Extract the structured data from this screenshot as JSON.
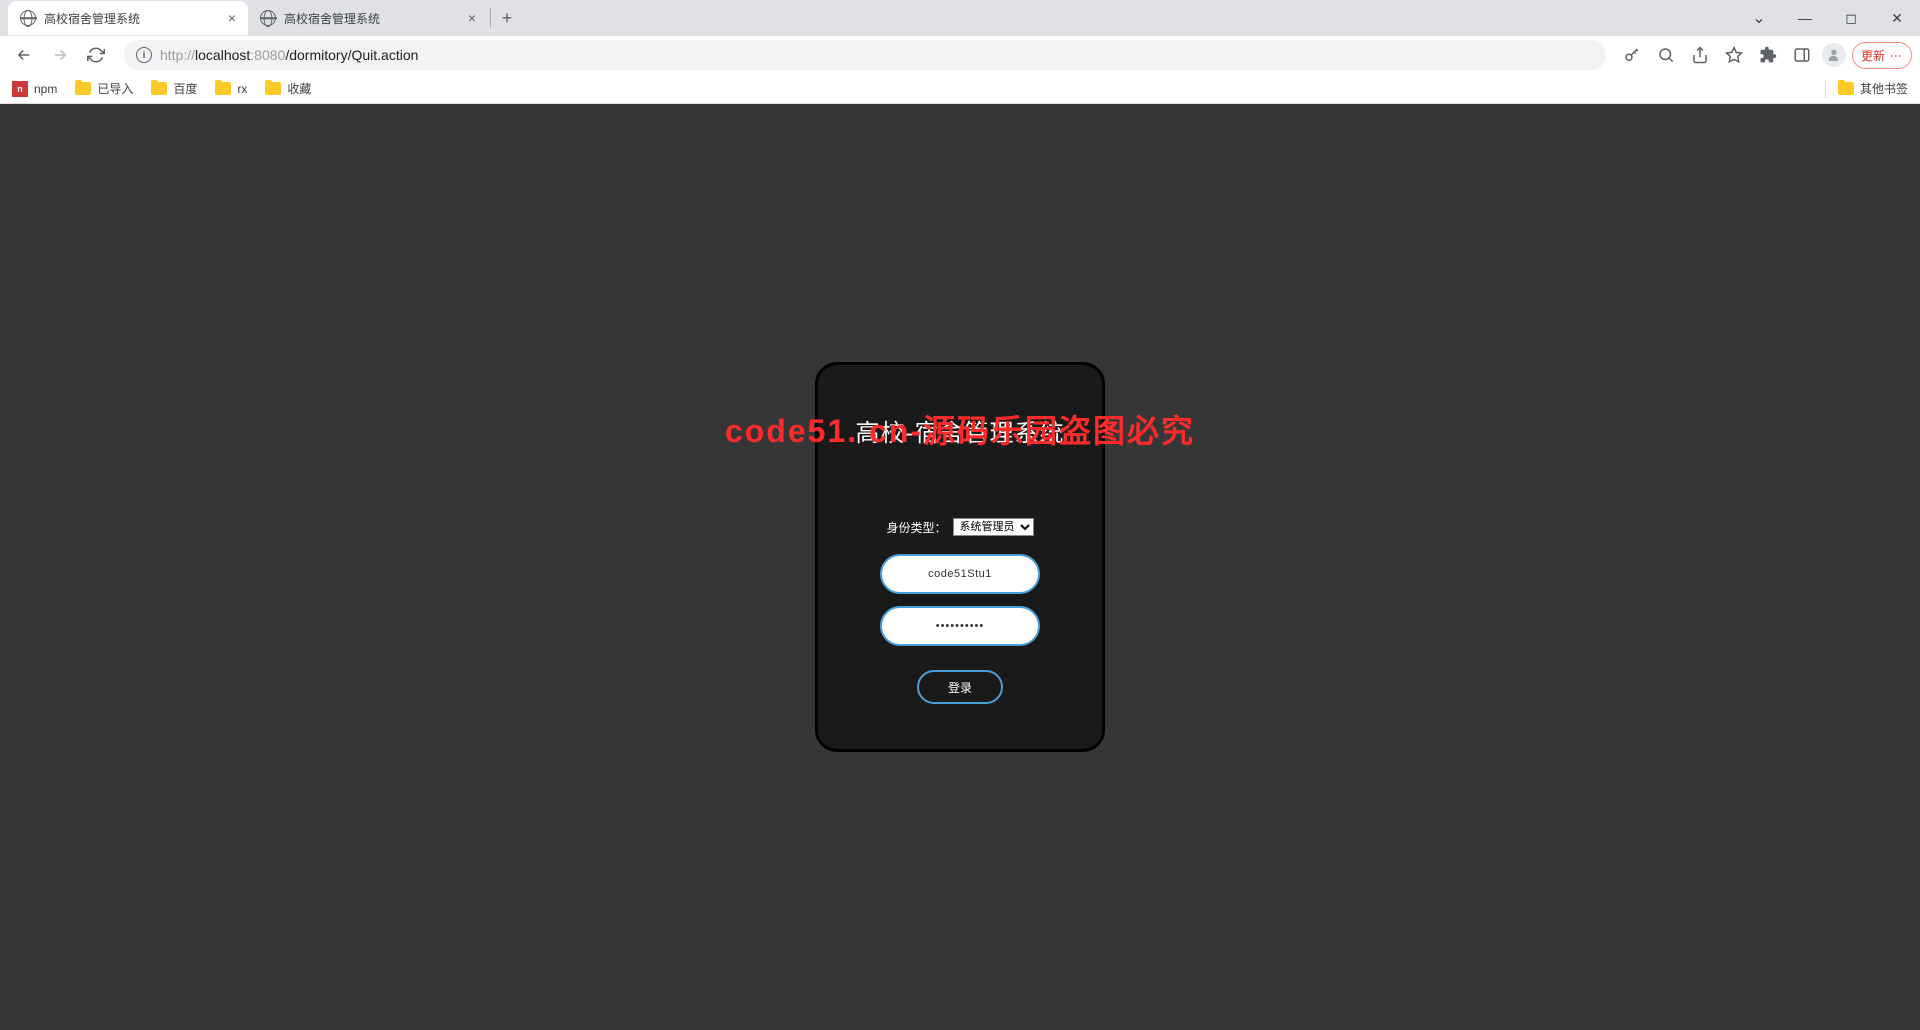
{
  "browser": {
    "tabs": [
      {
        "title": "高校宿舍管理系统",
        "active": true
      },
      {
        "title": "高校宿舍管理系统",
        "active": false
      }
    ],
    "url_prefix": "http://",
    "url_host": "localhost",
    "url_port": ":8080",
    "url_path": "/dormitory/Quit.action",
    "bookmarks": {
      "npm": "npm",
      "imported": "已导入",
      "baidu": "百度",
      "rx": "rx",
      "fav": "收藏",
      "other": "其他书签"
    },
    "update_label": "更新"
  },
  "watermark": "code51. cn-源码乐园盗图必究",
  "login": {
    "title": "高校-宿舍管理系统",
    "role_label": "身份类型：",
    "role_value": "系统管理员",
    "username": "code51Stu1",
    "password": "••••••••••",
    "submit": "登录"
  }
}
